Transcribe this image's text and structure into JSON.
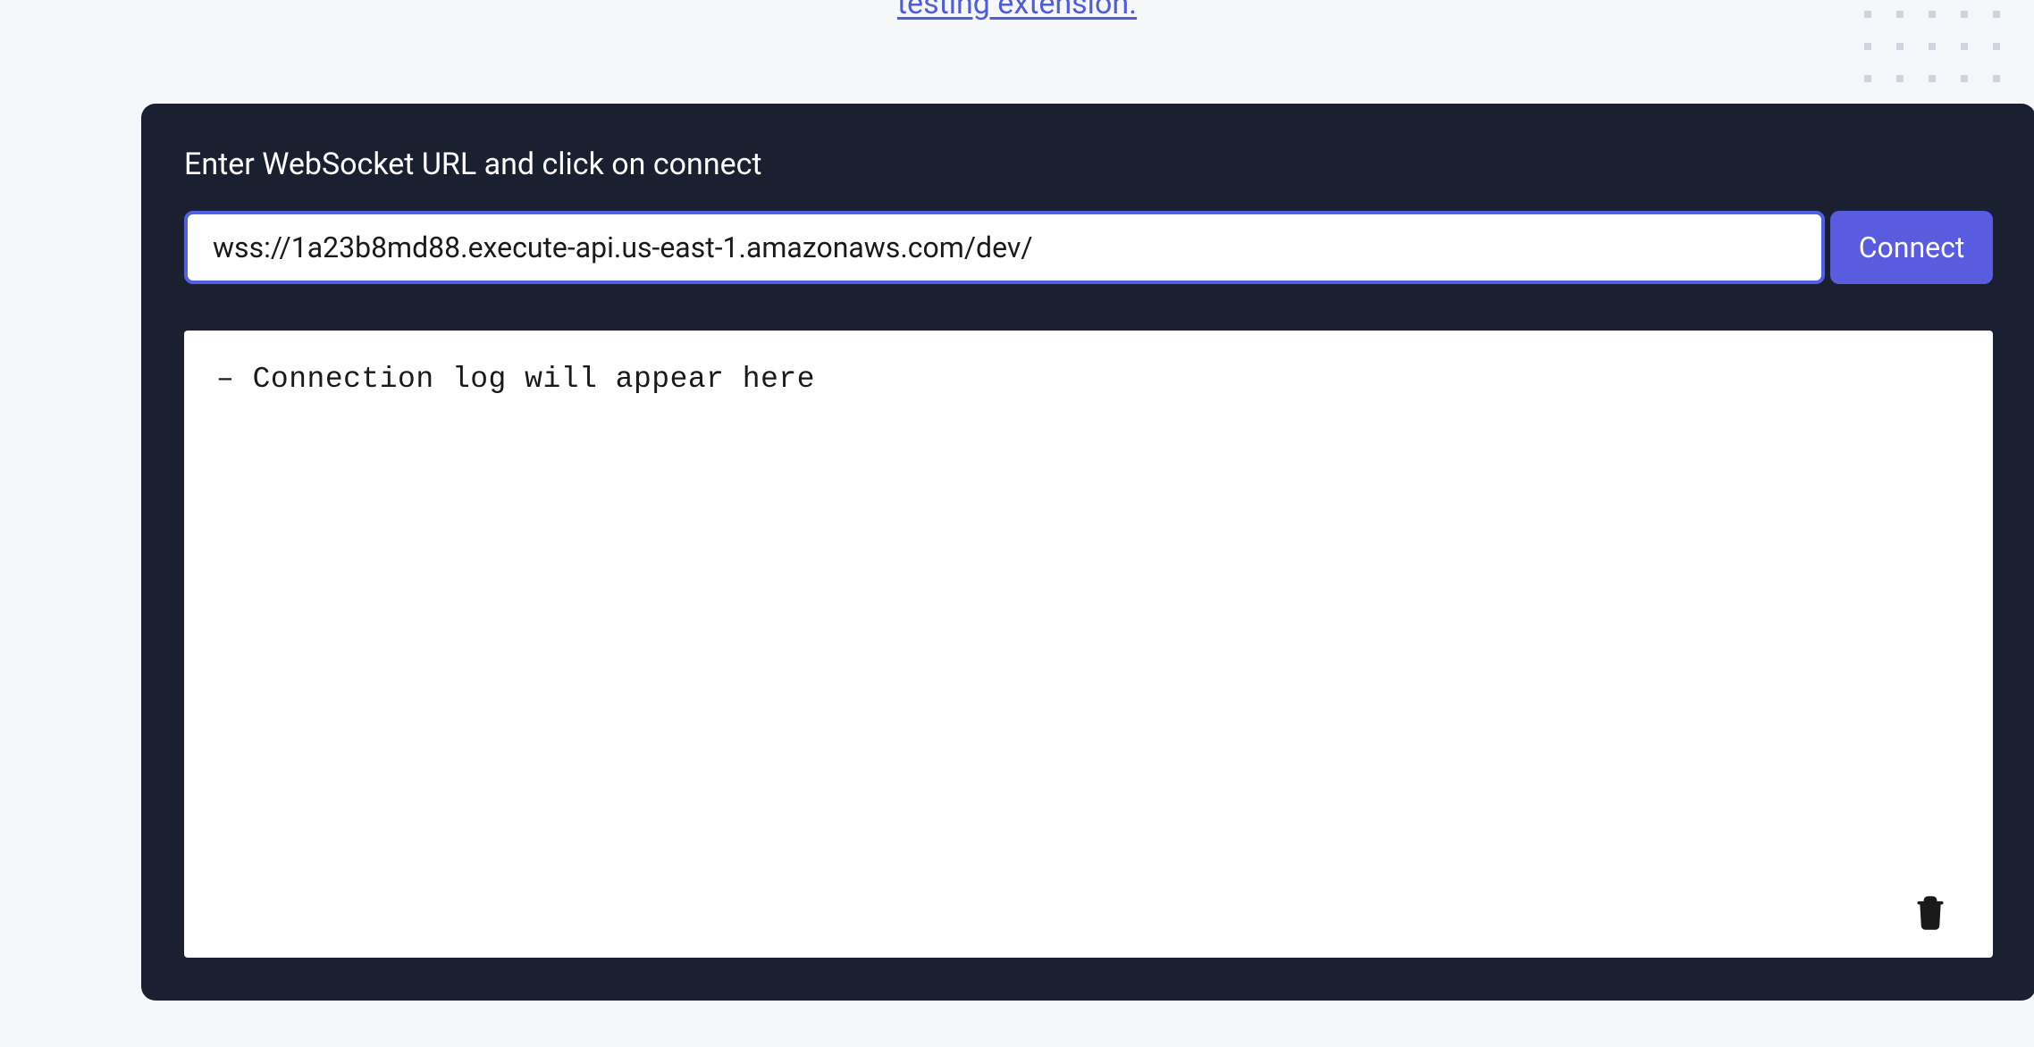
{
  "header": {
    "link_text": "testing extension."
  },
  "card": {
    "title": "Enter WebSocket URL and click on connect",
    "url_input_value": "wss://1a23b8md88.execute-api.us-east-1.amazonaws.com/dev/",
    "connect_button_label": "Connect",
    "log_placeholder": "– Connection log will appear here"
  }
}
